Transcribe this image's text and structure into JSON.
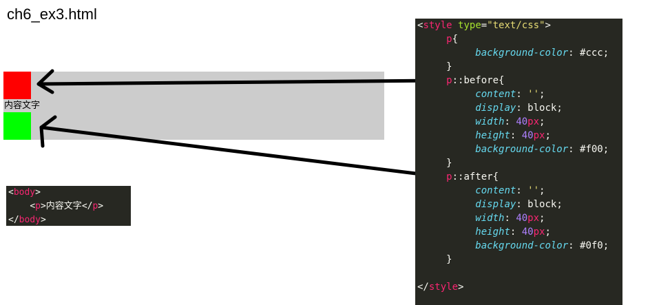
{
  "page": {
    "title": "ch6_ex3.html"
  },
  "demo": {
    "text": "内容文字",
    "before_color": "#ff0000",
    "after_color": "#00ff00",
    "p_background": "#cccccc"
  },
  "html_code": {
    "body_open_lt": "<",
    "body_open_tag": "body",
    "body_open_gt": ">",
    "p_indent": "    ",
    "p_open_lt": "<",
    "p_open_tag": "p",
    "p_open_gt": ">",
    "p_text": "内容文字",
    "p_close_lt": "</",
    "p_close_tag": "p",
    "p_close_gt": ">",
    "body_close_lt": "</",
    "body_close_tag": "body",
    "body_close_gt": ">"
  },
  "css_code": {
    "style_lt": "<",
    "style_tag": "style",
    "style_attr": "type",
    "style_eq": "=",
    "style_attr_value": "\"text/css\"",
    "style_gt": ">",
    "p_selector": "p",
    "brace_open": "{",
    "brace_close": "}",
    "colon": ": ",
    "semicolon": ";",
    "prop_background": "background-color",
    "val_ccc": "#ccc",
    "before_selector_p": "p",
    "before_pseudo": "::before",
    "after_selector_p": "p",
    "after_pseudo": "::after",
    "prop_content": "content",
    "val_content": "''",
    "prop_display": "display",
    "val_display": "block",
    "prop_width": "width",
    "prop_height": "height",
    "val_num": "40",
    "val_unit": "px",
    "val_f00": "#f00",
    "val_0f0": "#0f0",
    "style_close_lt": "</",
    "style_close_tag": "style",
    "style_close_gt": ">"
  },
  "colors": {
    "editor_bg": "#272822",
    "tag": "#f92672",
    "attr": "#a6e22e",
    "string": "#e6db74",
    "property": "#66d9ef",
    "number": "#ae81ff"
  }
}
